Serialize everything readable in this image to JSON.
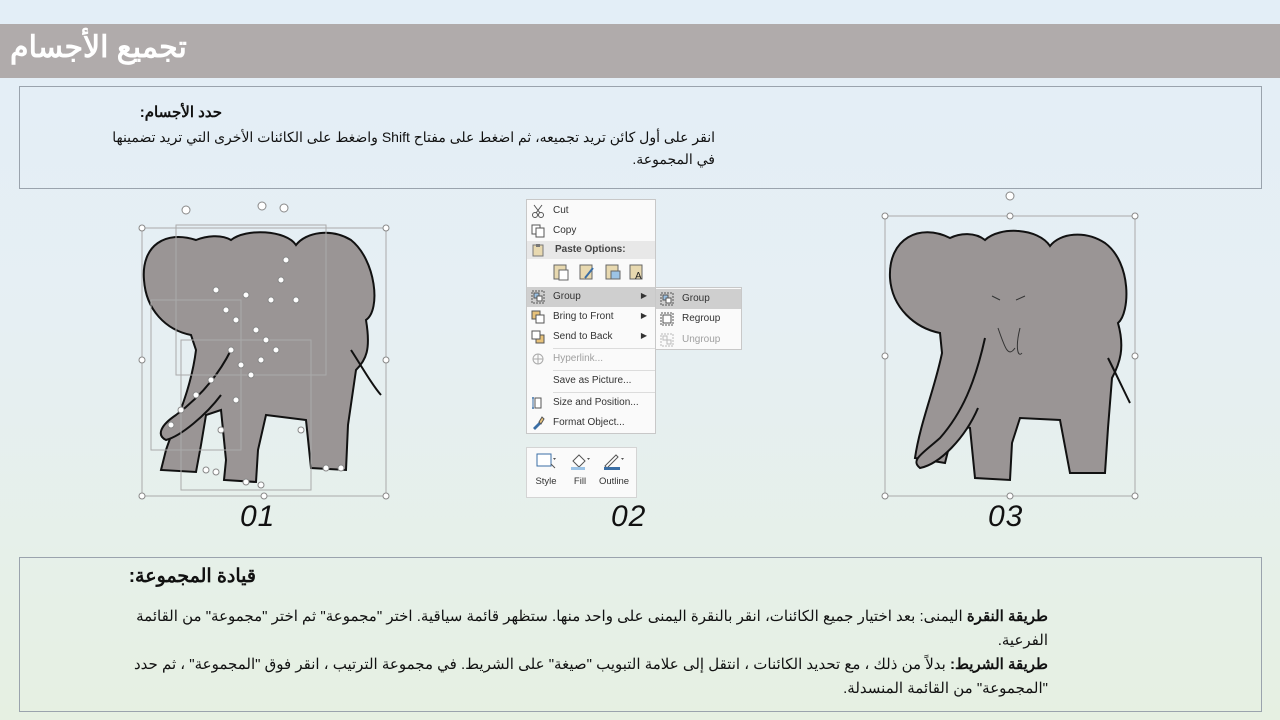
{
  "slide": {
    "title": "تجميع الأجسام",
    "box1": {
      "heading": "حدد الأجسام:",
      "text": "انقر على أول كائن تريد تجميعه، ثم اضغط على مفتاح Shift واضغط على الكائنات الأخرى التي تريد تضمينها في المجموعة."
    },
    "steps": [
      "01",
      "02",
      "03"
    ],
    "box2": {
      "heading": "قيادة المجموعة:",
      "p1_bold": "طريقة النقرة",
      "p1_text": " اليمنى: بعد اختيار جميع الكائنات، انقر بالنقرة اليمنى على واحد منها. ستظهر قائمة سياقية. اختر \"مجموعة\" ثم اختر \"مجموعة\" من القائمة الفرعية.",
      "p2_bold": "طريقة الشريط:",
      "p2_text": " بدلاً من ذلك ، مع تحديد الكائنات ، انتقل إلى علامة التبويب \"صيغة\" على الشريط. في مجموعة الترتيب ، انقر فوق \"المجموعة\" ، ثم حدد \"المجموعة\" من القائمة المنسدلة."
    }
  },
  "context_menu": {
    "items": [
      {
        "label": "Cut",
        "icon": "scissors-icon"
      },
      {
        "label": "Copy",
        "icon": "copy-icon"
      },
      {
        "label": "Paste Options:",
        "icon": "clipboard-icon"
      },
      {
        "label": "Group",
        "icon": "group-icon"
      },
      {
        "label": "Bring to Front",
        "icon": "bring-front-icon"
      },
      {
        "label": "Send to Back",
        "icon": "send-back-icon"
      },
      {
        "label": "Hyperlink...",
        "icon": "link-icon"
      },
      {
        "label": "Save as Picture...",
        "icon": ""
      },
      {
        "label": "Size and Position...",
        "icon": "size-icon"
      },
      {
        "label": "Format Object...",
        "icon": "format-icon"
      }
    ],
    "submenu": [
      {
        "label": "Group"
      },
      {
        "label": "Regroup"
      },
      {
        "label": "Ungroup"
      }
    ]
  },
  "mini_toolbar": {
    "style": "Style",
    "fill": "Fill",
    "outline": "Outline"
  },
  "colors": {
    "title_bar": "#b0abab",
    "elephant": "#9a9595",
    "highlight": "#cfcfcf"
  }
}
